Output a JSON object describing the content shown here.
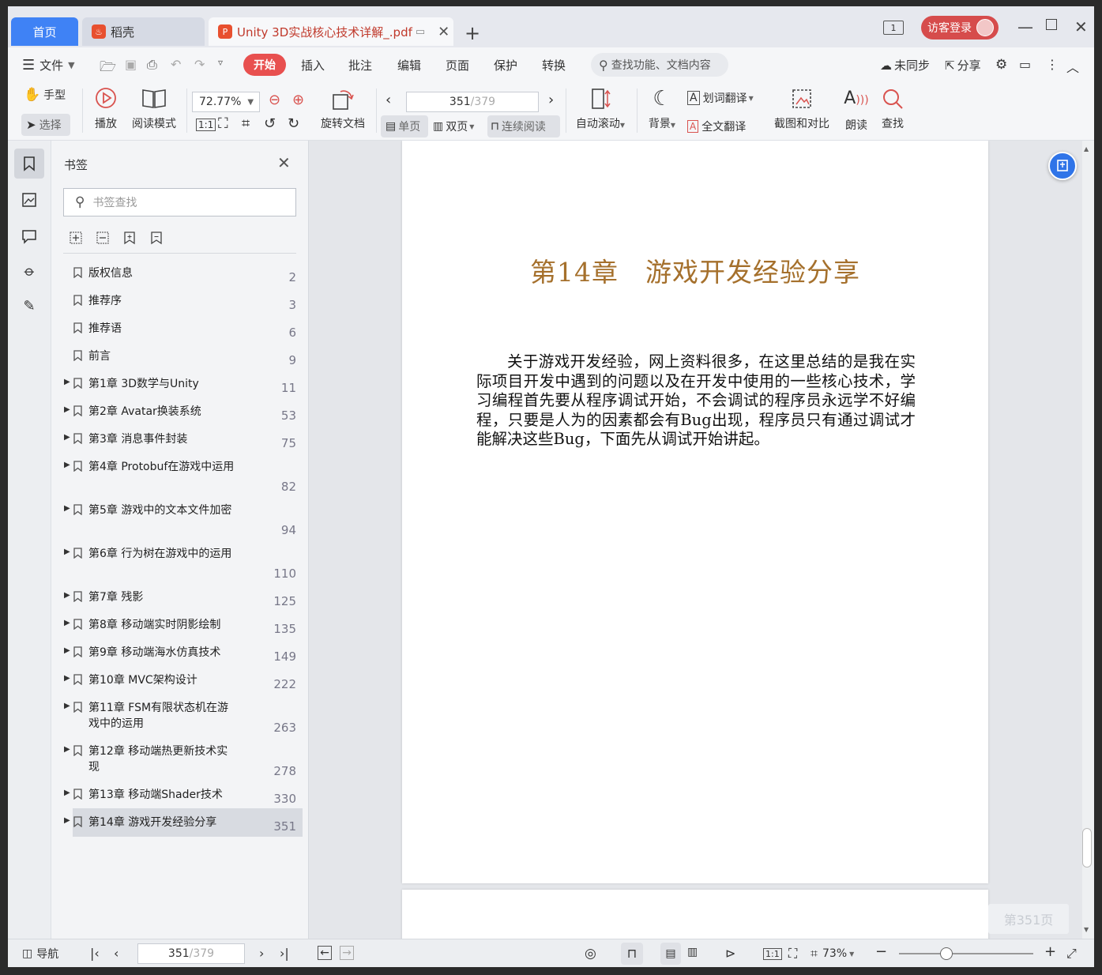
{
  "titlebar": {
    "tab_home": "首页",
    "tab_daoke": "稻壳",
    "tab_doc": "Unity 3D实战核心技术详解_.pdf",
    "window_count": "1",
    "login": "访客登录"
  },
  "menubar": {
    "file": "文件",
    "items": [
      "开始",
      "插入",
      "批注",
      "编辑",
      "页面",
      "保护",
      "转换"
    ],
    "search_placeholder": "查找功能、文档内容",
    "sync": "未同步",
    "share": "分享"
  },
  "toolbar": {
    "hand": "手型",
    "select": "选择",
    "play": "播放",
    "read_mode": "阅读模式",
    "zoom": "72.77%",
    "rotate": "旋转文档",
    "page_current": "351",
    "page_total": "/379",
    "single": "单页",
    "double": "双页",
    "continuous": "连续阅读",
    "auto_scroll": "自动滚动",
    "background": "背景",
    "word_translate": "划词翻译",
    "full_translate": "全文翻译",
    "screenshot": "截图和对比",
    "read_aloud": "朗读",
    "find": "查找"
  },
  "panel": {
    "title": "书签",
    "search_placeholder": "书签查找",
    "bookmarks": [
      {
        "label": "版权信息",
        "page": "2",
        "expandable": false
      },
      {
        "label": "推荐序",
        "page": "3",
        "expandable": false
      },
      {
        "label": "推荐语",
        "page": "6",
        "expandable": false
      },
      {
        "label": "前言",
        "page": "9",
        "expandable": false
      },
      {
        "label": "第1章 3D数学与Unity",
        "page": "11",
        "expandable": true
      },
      {
        "label": "第2章 Avatar换装系统",
        "page": "53",
        "expandable": true
      },
      {
        "label": "第3章 消息事件封装",
        "page": "75",
        "expandable": true
      },
      {
        "label": "第4章 Protobuf在游戏中运用",
        "page": "82",
        "expandable": true
      },
      {
        "label": "第5章 游戏中的文本文件加密",
        "page": "94",
        "expandable": true
      },
      {
        "label": "第6章 行为树在游戏中的运用",
        "page": "110",
        "expandable": true
      },
      {
        "label": "第7章 残影",
        "page": "125",
        "expandable": true
      },
      {
        "label": "第8章 移动端实时阴影绘制",
        "page": "135",
        "expandable": true
      },
      {
        "label": "第9章 移动端海水仿真技术",
        "page": "149",
        "expandable": true
      },
      {
        "label": "第10章 MVC架构设计",
        "page": "222",
        "expandable": true
      },
      {
        "label": "第11章 FSM有限状态机在游戏中的运用",
        "page": "263",
        "expandable": true
      },
      {
        "label": "第12章 移动端热更新技术实现",
        "page": "278",
        "expandable": true
      },
      {
        "label": "第13章 移动端Shader技术",
        "page": "330",
        "expandable": true
      },
      {
        "label": "第14章 游戏开发经验分享",
        "page": "351",
        "expandable": true,
        "active": true
      }
    ]
  },
  "document": {
    "chapter_title": "第14章　游戏开发经验分享",
    "body": "关于游戏开发经验，网上资料很多，在这里总结的是我在实际项目开发中遇到的问题以及在开发中使用的一些核心技术，学习编程首先要从程序调试开始，不会调试的程序员永远学不好编程，只要是人为的因素都会有Bug出现，程序员只有通过调试才能解决这些Bug，下面先从调试开始讲起。",
    "page_indicator": "第351页"
  },
  "statusbar": {
    "nav": "导航",
    "page_current": "351",
    "page_total": "/379",
    "zoom": "73%"
  },
  "colors": {
    "accent": "#3f82f5",
    "start_tab": "#e8504f",
    "chapter_title": "#a5702c"
  }
}
